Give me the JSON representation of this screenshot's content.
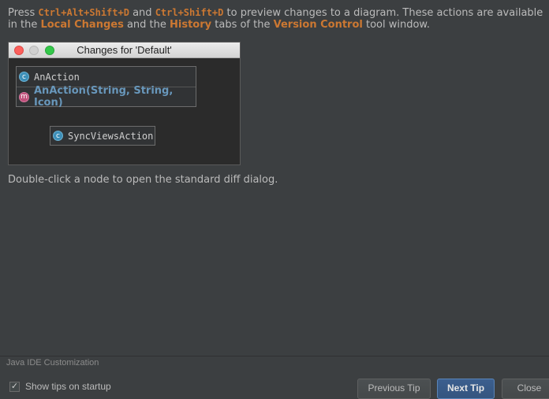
{
  "tip": {
    "line1": {
      "p1": "Press ",
      "k1": "Ctrl+Alt+Shift+D",
      "p2": " and ",
      "k2": "Ctrl+Shift+D",
      "p3": " to preview changes to a diagram. These actions are available"
    },
    "line2": {
      "p1": "in the ",
      "h1": "Local Changes",
      "p2": " and the ",
      "h2": "History",
      "p3": " tabs of the ",
      "h3": "Version Control",
      "p4": " tool window."
    },
    "after": "Double-click a node to open the standard diff dialog."
  },
  "preview": {
    "window_title": "Changes for 'Default'",
    "nodes": {
      "class1": {
        "icon_letter": "c",
        "label": "AnAction"
      },
      "method1": {
        "icon_letter": "m",
        "label": "AnAction(String, String, Icon)"
      },
      "class2": {
        "icon_letter": "c",
        "label": "SyncViewsAction"
      }
    }
  },
  "footer": {
    "category": "Java IDE Customization",
    "show_tips_label": "Show tips on startup",
    "show_tips_checked": true,
    "check_glyph": "✓",
    "prev_button": "Previous Tip",
    "next_button": "Next Tip",
    "close_button": "Close"
  },
  "colors": {
    "background": "#3c3f41",
    "text": "#bbbbbb",
    "shortcut_highlight": "#cc7832",
    "changed_method": "#6897bb",
    "primary_button": "#365880"
  }
}
